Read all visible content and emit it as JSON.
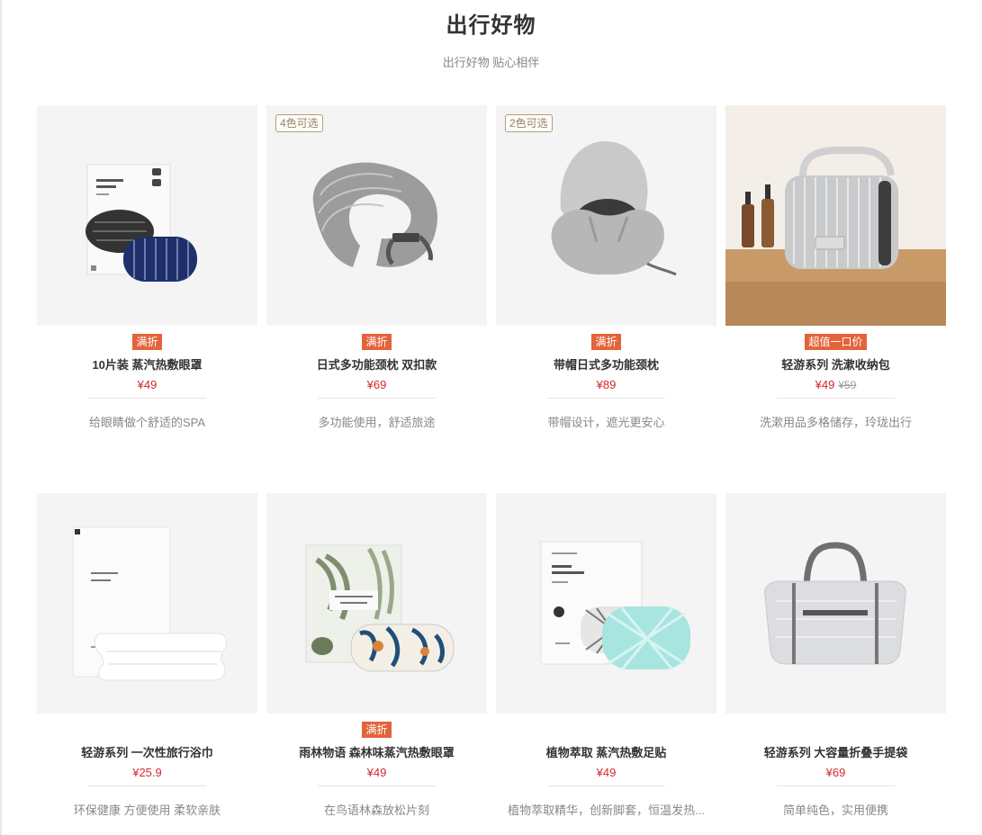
{
  "header": {
    "title": "出行好物",
    "subtitle": "出行好物 贴心相伴"
  },
  "colors": {
    "promo": "#e4633a",
    "price": "#d4282d",
    "tag_border": "#b4a078"
  },
  "products": [
    {
      "name": "10片装 蒸汽热敷眼罩",
      "price": "¥49",
      "orig_price": "",
      "promo": "满折",
      "color_tag": "",
      "desc": "给眼睛做个舒适的SPA",
      "image": "steam-eye-mask-image"
    },
    {
      "name": "日式多功能颈枕 双扣款",
      "price": "¥69",
      "orig_price": "",
      "promo": "满折",
      "color_tag": "4色可选",
      "desc": "多功能使用，舒适旅途",
      "image": "neck-pillow-image"
    },
    {
      "name": "带帽日式多功能颈枕",
      "price": "¥89",
      "orig_price": "",
      "promo": "满折",
      "color_tag": "2色可选",
      "desc": "带帽设计，遮光更安心",
      "image": "hooded-neck-pillow-image"
    },
    {
      "name": "轻游系列 洗漱收纳包",
      "price": "¥49",
      "orig_price": "¥59",
      "promo": "超值一口价",
      "color_tag": "",
      "desc": "洗漱用品多格储存，玲珑出行",
      "image": "toiletry-bag-image"
    },
    {
      "name": "轻游系列 一次性旅行浴巾",
      "price": "¥25.9",
      "orig_price": "",
      "promo": "",
      "color_tag": "",
      "desc": "环保健康 方便使用 柔软亲肤",
      "image": "travel-towel-image"
    },
    {
      "name": "雨林物语 森林味蒸汽热敷眼罩",
      "price": "¥49",
      "orig_price": "",
      "promo": "满折",
      "color_tag": "",
      "desc": "在鸟语林森放松片刻",
      "image": "forest-eye-mask-image"
    },
    {
      "name": "植物萃取 蒸汽热敷足贴",
      "price": "¥49",
      "orig_price": "",
      "promo": "",
      "color_tag": "",
      "desc": "植物萃取精华，创新脚套，恒温发热...",
      "image": "foot-patch-image"
    },
    {
      "name": "轻游系列 大容量折叠手提袋",
      "price": "¥69",
      "orig_price": "",
      "promo": "",
      "color_tag": "",
      "desc": "简单纯色，实用便携",
      "image": "duffel-bag-image"
    }
  ]
}
